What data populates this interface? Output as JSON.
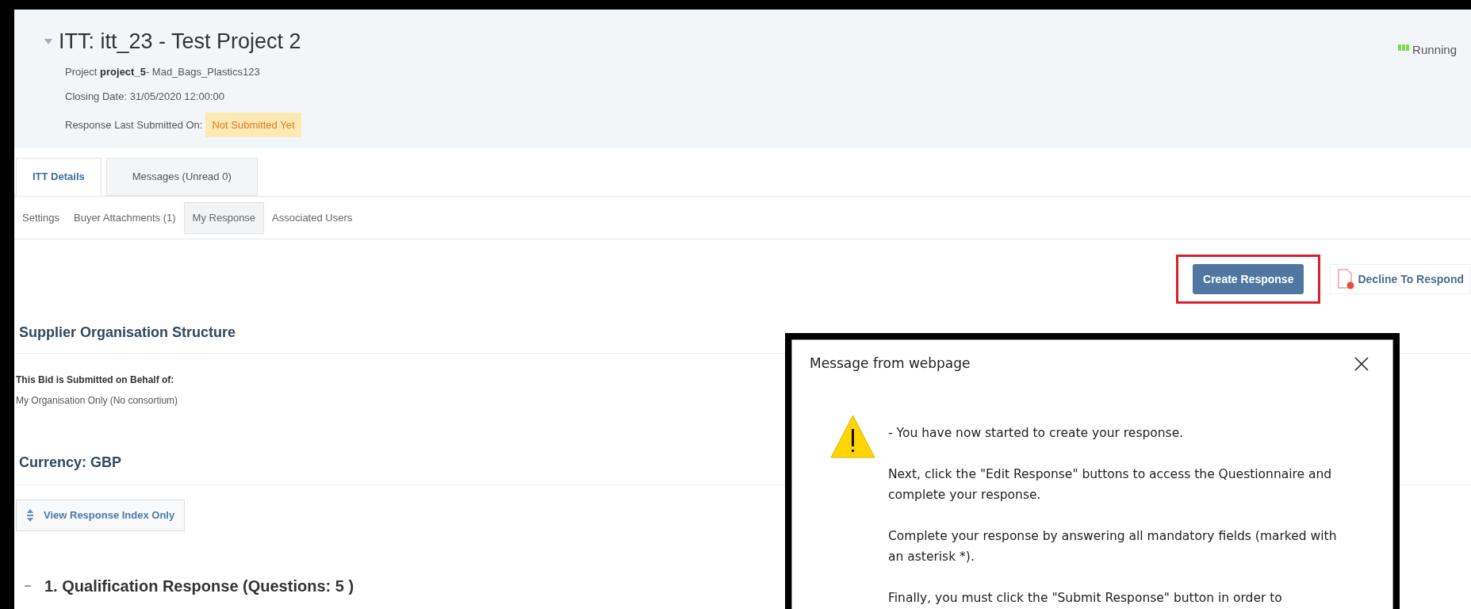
{
  "header": {
    "title": "ITT: itt_23 - Test Project 2",
    "project_label": "Project",
    "project_code": "project_5",
    "project_name": "- Mad_Bags_Plastics123",
    "closing_date": "Closing Date: 31/05/2020 12:00:00",
    "last_submitted_label": "Response Last Submitted On:",
    "last_submitted_value": "Not Submitted Yet",
    "status": "Running"
  },
  "tabs": [
    {
      "label": "ITT Details",
      "selected": true
    },
    {
      "label": "Messages (Unread 0)",
      "selected": false
    }
  ],
  "subtabs": [
    {
      "label": "Settings",
      "selected": false
    },
    {
      "label": "Buyer Attachments (1)",
      "selected": false
    },
    {
      "label": "My Response",
      "selected": true
    },
    {
      "label": "Associated Users",
      "selected": false
    }
  ],
  "actions": [
    {
      "label": "Create Response",
      "kind": "primary",
      "highlighted": true
    },
    {
      "label": "Decline To Respond",
      "kind": "document",
      "highlighted": false
    }
  ],
  "supplier": {
    "heading": "Supplier Organisation Structure",
    "label": "This Bid is Submitted on Behalf of:",
    "value": "My Organisation Only (No consortium)"
  },
  "currency": {
    "heading": "Currency: GBP"
  },
  "view_index_button": "View Response Index Only",
  "section": {
    "title": "1. Qualification Response (Questions: 5 )",
    "expanded": true
  },
  "dialog": {
    "title": "Message from webpage",
    "paragraphs": [
      "- You have now started to create your response.",
      "Next, click the \"Edit Response\" buttons to access the Questionnaire and complete your response.",
      "Complete your response by answering all mandatory fields (marked with an asterisk *).",
      "Finally, you must click the \"Submit Response\" button in order to"
    ]
  }
}
